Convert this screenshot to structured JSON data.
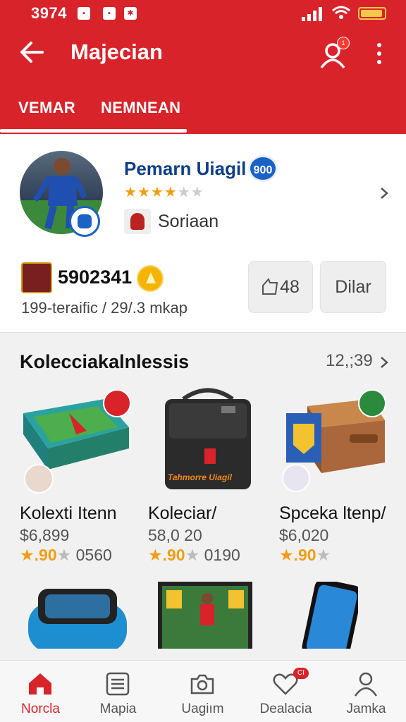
{
  "status_bar": {
    "time": "3974"
  },
  "header": {
    "title": "Majecian",
    "notification_count": "1",
    "tabs": [
      {
        "label": "VEMAR",
        "active": true
      },
      {
        "label": "NEMNEAN",
        "active": false
      }
    ],
    "accent": "#d8232a"
  },
  "profile": {
    "name": "Pemarn Uiagil",
    "score": "900",
    "rating_stars": 4,
    "rating_max": 5,
    "club": "Soriaan",
    "value": "5902341",
    "subline": "199-teraific / 29/.3 mkap",
    "likes_label": "48",
    "action_label": "Dilar"
  },
  "collections": {
    "title": "Kolecciakalnlessis",
    "count": "12,;39",
    "items": [
      {
        "name": "Kolexti Itenn",
        "price": "$6,899",
        "rating": ".90",
        "count": "0560"
      },
      {
        "name": "Koleciar/",
        "price": "58,0 20",
        "rating": ".90",
        "count": "0190",
        "product_text": "Tahmorre Uiagil"
      },
      {
        "name": "Spceka ltenp/",
        "price": "$6,020",
        "rating": ".90",
        "count": ""
      }
    ]
  },
  "bottom_nav": [
    {
      "label": "Norcla",
      "icon": "home-icon",
      "active": true
    },
    {
      "label": "Mapia",
      "icon": "list-icon",
      "active": false
    },
    {
      "label": "Uagiım",
      "icon": "camera-icon",
      "active": false
    },
    {
      "label": "Dealacia",
      "icon": "heart-icon",
      "active": false,
      "badge": "CI"
    },
    {
      "label": "Jamka",
      "icon": "person-icon",
      "active": false
    }
  ]
}
